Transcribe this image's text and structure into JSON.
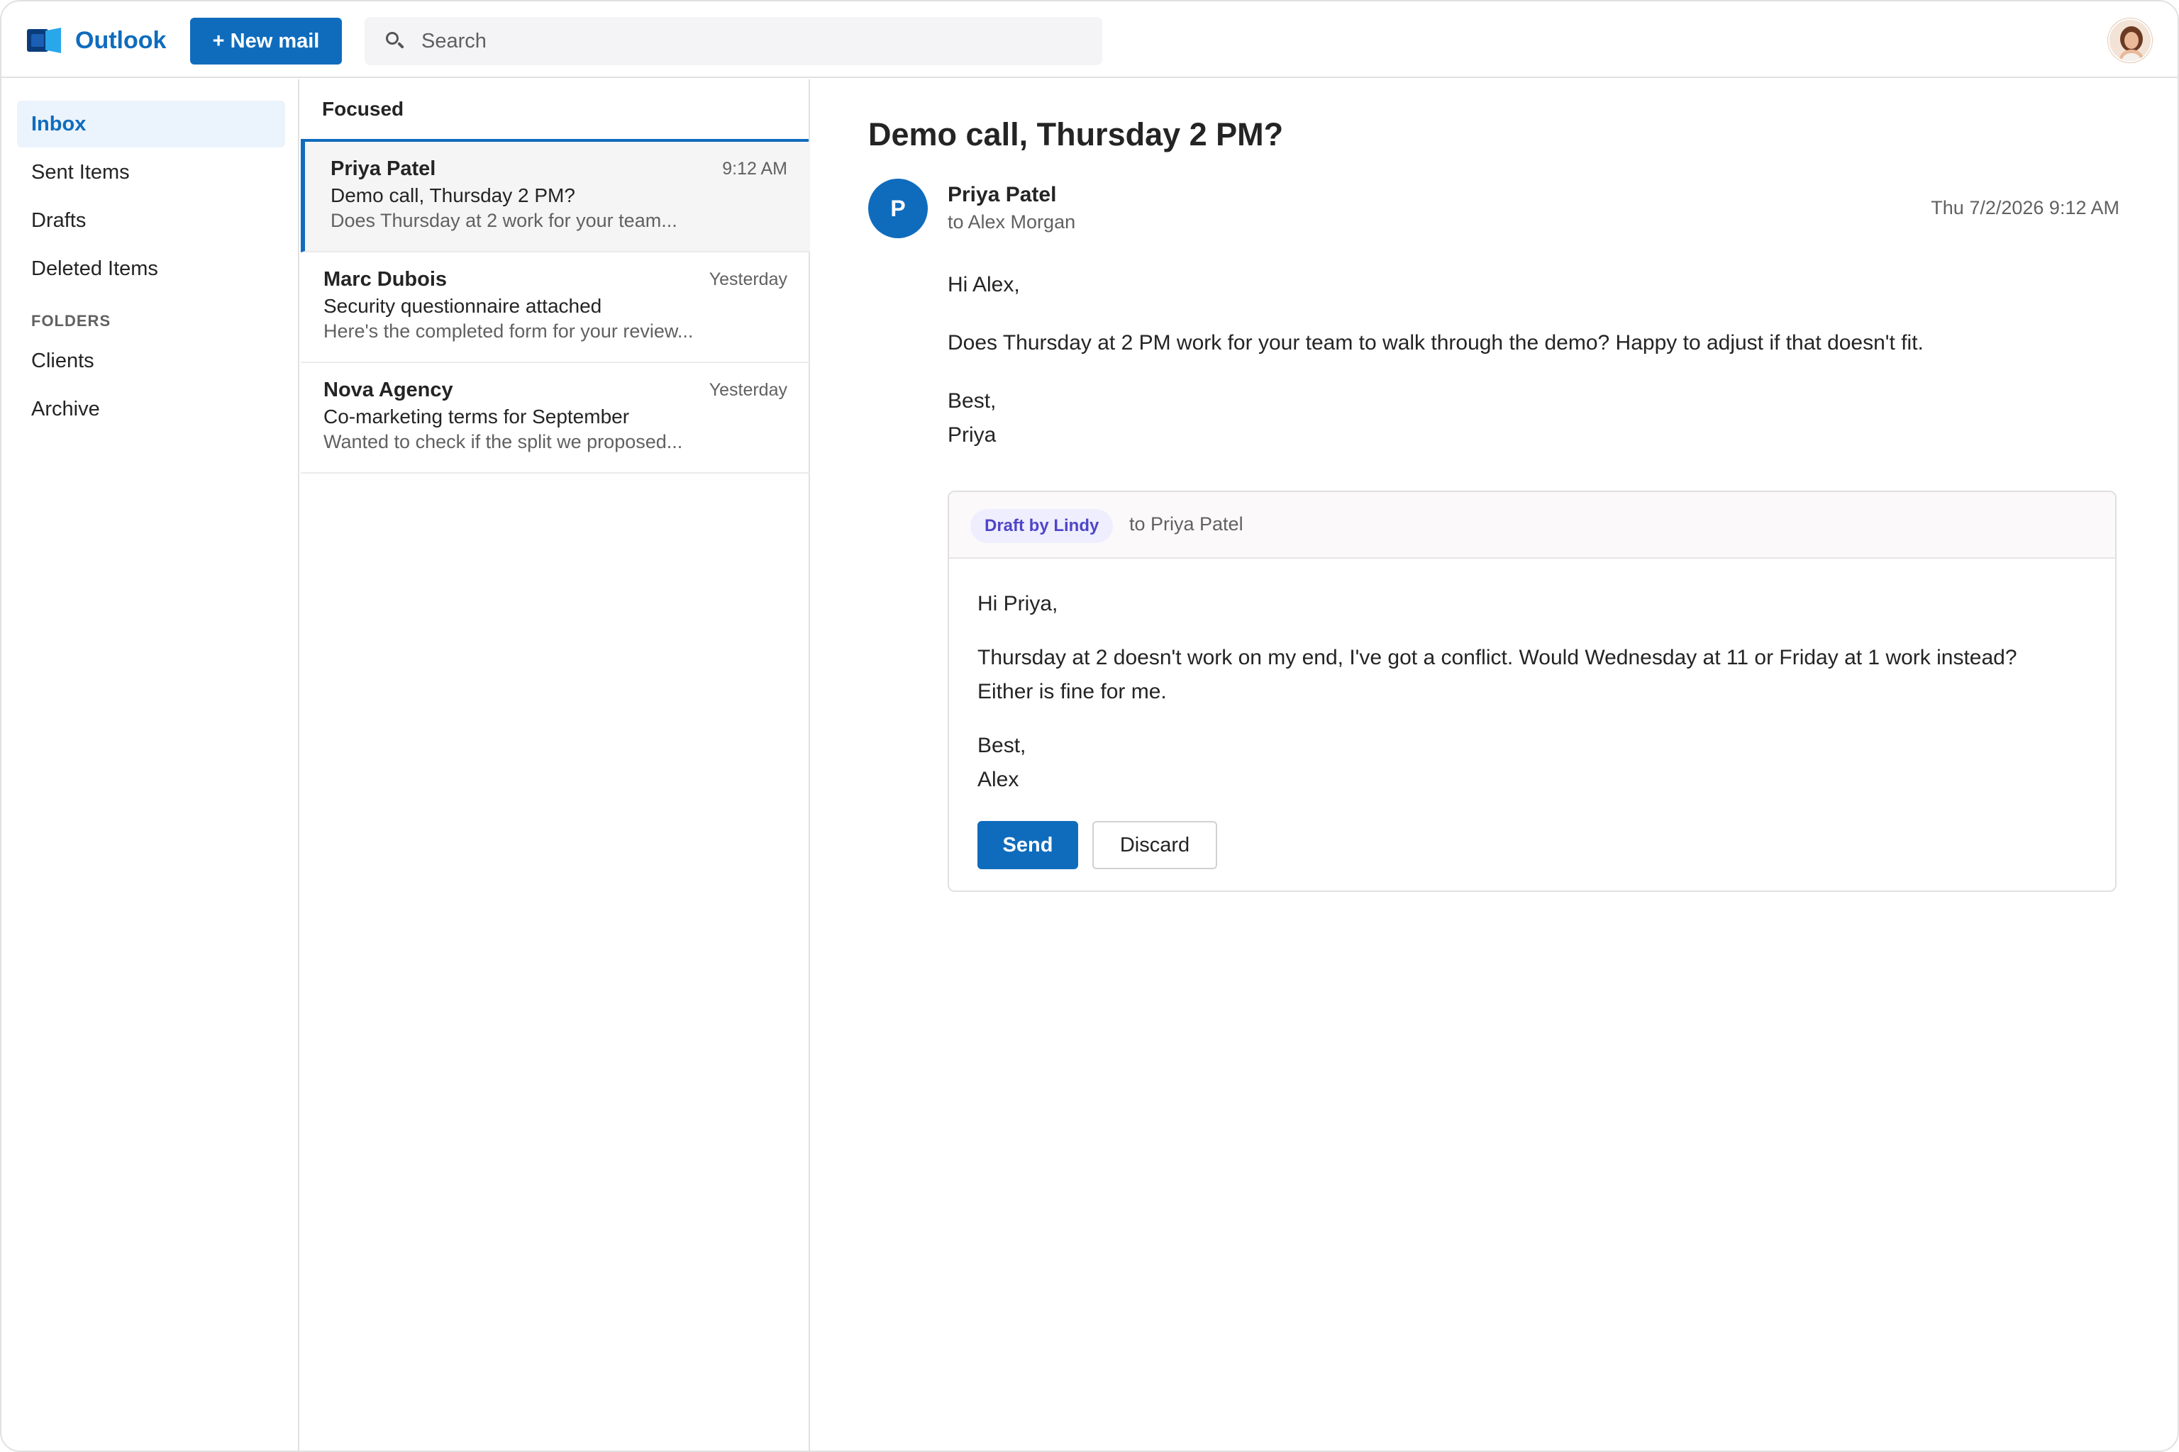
{
  "app": {
    "name": "Outlook",
    "accent": "#0f6cbd",
    "new_mail_label": "+ New mail",
    "search_placeholder": "Search"
  },
  "sidebar": {
    "items": [
      {
        "label": "Inbox",
        "active": true
      },
      {
        "label": "Sent Items"
      },
      {
        "label": "Drafts"
      },
      {
        "label": "Deleted Items"
      }
    ],
    "folders_heading": "FOLDERS",
    "folders": [
      {
        "label": "Clients"
      },
      {
        "label": "Archive"
      }
    ]
  },
  "list": {
    "header": "Focused",
    "messages": [
      {
        "from": "Priya Patel",
        "time": "9:12 AM",
        "subject": "Demo call, Thursday 2 PM?",
        "preview": "Does Thursday at 2 work for your team...",
        "selected": true
      },
      {
        "from": "Marc Dubois",
        "time": "Yesterday",
        "subject": "Security questionnaire attached",
        "preview": "Here's the completed form for your review..."
      },
      {
        "from": "Nova Agency",
        "time": "Yesterday",
        "subject": "Co-marketing terms for September",
        "preview": "Wanted to check if the split we proposed..."
      }
    ]
  },
  "reading": {
    "subject": "Demo call, Thursday 2 PM?",
    "sender_initial": "P",
    "sender_name": "Priya Patel",
    "to": "to Alex Morgan",
    "date": "Thu 7/2/2026 9:12 AM",
    "body": {
      "greeting": "Hi Alex,",
      "paragraph": "Does Thursday at 2 PM work for your team to walk through the demo? Happy to adjust if that doesn't fit.",
      "signoff": "Best,",
      "signature": "Priya"
    },
    "draft": {
      "badge": "Draft by Lindy",
      "to": "to Priya Patel",
      "greeting": "Hi Priya,",
      "line1": "Thursday at 2 doesn't work on my end, I've got a conflict. Would Wednesday at 11 or Friday at 1 work instead?",
      "line2": "Either is fine for me.",
      "signoff": "Best,",
      "signature": "Alex",
      "send_label": "Send",
      "discard_label": "Discard"
    }
  }
}
